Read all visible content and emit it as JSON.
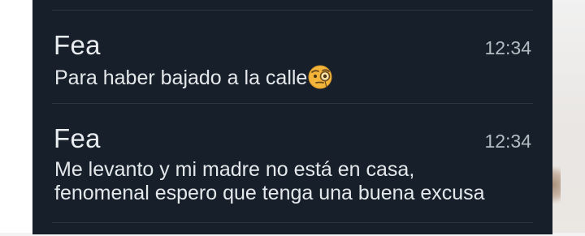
{
  "notifications": [
    {
      "sender": "Fea",
      "time": "12:34",
      "message": "Para haber bajado a la calle",
      "emoji_icon": "face-with-monocle-icon"
    },
    {
      "sender": "Fea",
      "time": "12:34",
      "message_lines": [
        "Me levanto y mi madre no está en casa,",
        "fenomenal espero que tenga una buena excusa"
      ]
    }
  ],
  "colors": {
    "panel_bg": "#17202a",
    "divider": "#2c3640",
    "sender_text": "#e8ecef",
    "message_text": "#e4e8eb",
    "time_text": "#b4bcc3",
    "emoji_yellow": "#f2b53a"
  }
}
